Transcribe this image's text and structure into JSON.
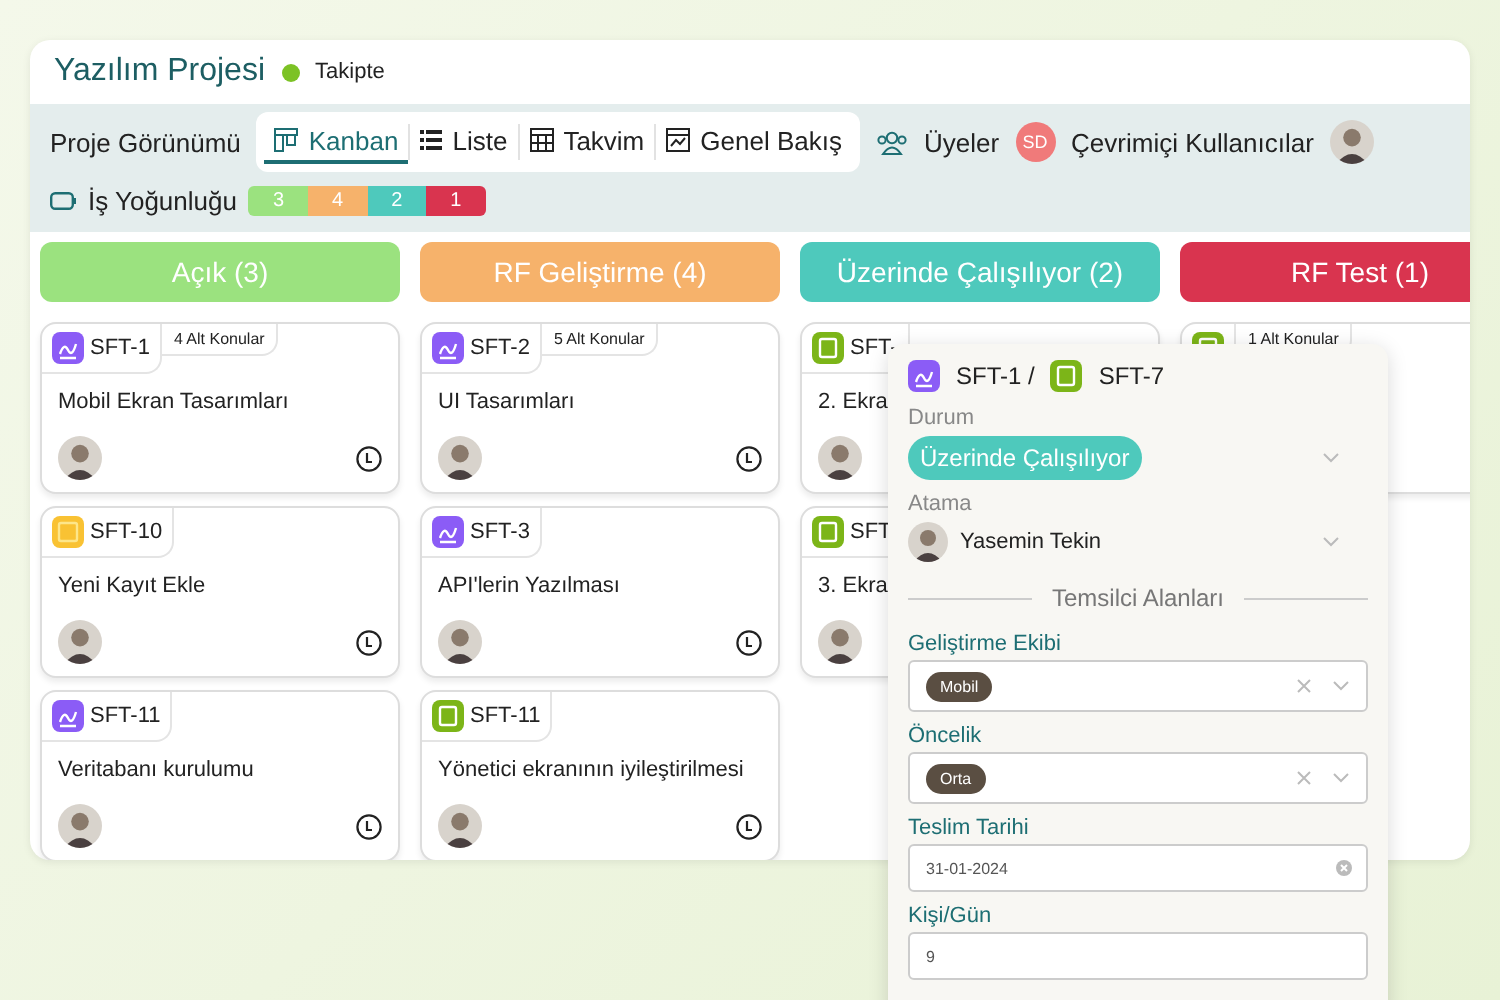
{
  "header": {
    "title": "Yazılım Projesi",
    "status": {
      "label": "Takipte",
      "color": "#7cc225"
    }
  },
  "toolbar": {
    "view_label": "Proje Görünümü",
    "views": [
      {
        "kind": "kanban",
        "label": "Kanban",
        "selected": true
      },
      {
        "kind": "list",
        "label": "Liste",
        "selected": false
      },
      {
        "kind": "calendar",
        "label": "Takvim",
        "selected": false
      },
      {
        "kind": "overview",
        "label": "Genel Bakış",
        "selected": false
      }
    ],
    "members": "Üyeler",
    "online_initials": "SD",
    "online_label": "Çevrimiçi Kullanıcılar"
  },
  "workload": {
    "label": "İş Yoğunluğu",
    "segments": [
      {
        "count": "3",
        "color": "#9be27f"
      },
      {
        "count": "4",
        "color": "#f6b26b"
      },
      {
        "count": "2",
        "color": "#4ec9bc"
      },
      {
        "count": "1",
        "color": "#d9344f"
      }
    ]
  },
  "columns": [
    {
      "title": "Açık (3)",
      "color": "#9be27f",
      "cards": [
        {
          "kind": "story",
          "id": "SFT-1",
          "subtasks": "4 Alt Konular",
          "title": "Mobil Ekran Tasarımları"
        },
        {
          "kind": "improvement",
          "id": "SFT-10",
          "title": "Yeni Kayıt Ekle"
        },
        {
          "kind": "story",
          "id": "SFT-11",
          "title": "Veritabanı kurulumu"
        }
      ]
    },
    {
      "title": "RF Geliştirme (4)",
      "color": "#f6b26b",
      "cards": [
        {
          "kind": "story",
          "id": "SFT-2",
          "subtasks": "5 Alt Konular",
          "title": "UI Tasarımları"
        },
        {
          "kind": "story",
          "id": "SFT-3",
          "title": "API'lerin Yazılması"
        },
        {
          "kind": "task",
          "id": "SFT-11",
          "title": "Yönetici ekranının iyileştirilmesi"
        }
      ]
    },
    {
      "title": "Üzerinde Çalışılıyor (2)",
      "color": "#4ec9bc",
      "cards": [
        {
          "kind": "task",
          "id": "SFT-",
          "title": "2. Ekra"
        },
        {
          "kind": "task",
          "id": "SFT",
          "title": "3. Ekra"
        }
      ]
    },
    {
      "title": "RF Test (1)",
      "color": "#d9344f",
      "cards": [
        {
          "kind": "task",
          "subtasks": "1 Alt Konular"
        }
      ]
    }
  ],
  "detail": {
    "parent": {
      "kind": "story",
      "id": "SFT-1 /"
    },
    "issue": {
      "kind": "task",
      "id": "SFT-7"
    },
    "fields": [
      {
        "kind": "status",
        "label": "Durum",
        "value": "Üzerinde Çalışılıyor"
      },
      {
        "kind": "person",
        "label": "Atama",
        "value": "Yasemin Tekin"
      },
      {
        "kind": "section",
        "label": "Temsilci Alanları"
      },
      {
        "kind": "select",
        "label": "Geliştirme Ekibi",
        "value": "Mobil"
      },
      {
        "kind": "select",
        "label": "Öncelik",
        "value": "Orta"
      },
      {
        "kind": "date",
        "label": "Teslim Tarihi",
        "value": "31-01-2024"
      },
      {
        "kind": "text",
        "label": "Kişi/Gün",
        "value": "9"
      }
    ]
  }
}
